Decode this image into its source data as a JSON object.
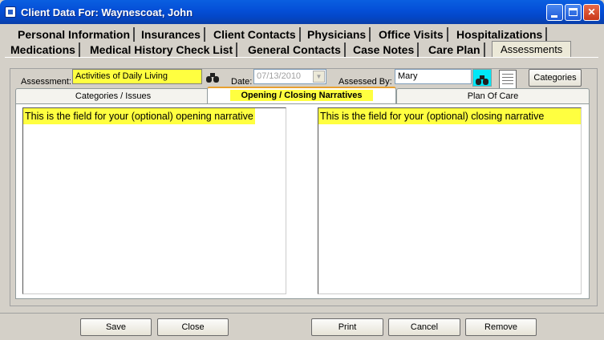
{
  "window": {
    "title": "Client Data For: Waynescoat, John"
  },
  "tabs_row1": [
    "Personal Information",
    "Insurances",
    "Client Contacts",
    "Physicians",
    "Office Visits",
    "Hospitalizations"
  ],
  "tabs_row2": [
    "Medications",
    "Medical History Check List",
    "General Contacts",
    "Case Notes",
    "Care Plan",
    "Assessments"
  ],
  "form": {
    "assessment_label": "Assessment:",
    "assessment_value": "Activities of Daily Living",
    "date_label": "Date:",
    "date_value": "07/13/2010",
    "assessed_by_label": "Assessed By:",
    "assessed_by_value": "Mary",
    "categories_button": "Categories"
  },
  "subtabs": [
    "Categories / Issues",
    "Opening / Closing Narratives",
    "Plan Of Care"
  ],
  "narratives": {
    "opening": "This is the field for your (optional) opening narrative",
    "closing": "This is the field for your (optional) closing narrative"
  },
  "buttons": {
    "save": "Save",
    "close": "Close",
    "print": "Print",
    "cancel": "Cancel",
    "remove": "Remove"
  },
  "colors": {
    "highlight": "#ffff40",
    "titlebar": "#0550d8",
    "dialog_bg": "#d4d0c8"
  },
  "icons": [
    "binoculars-icon",
    "document-icon",
    "app-icon",
    "minimize-icon",
    "maximize-icon",
    "close-icon"
  ]
}
